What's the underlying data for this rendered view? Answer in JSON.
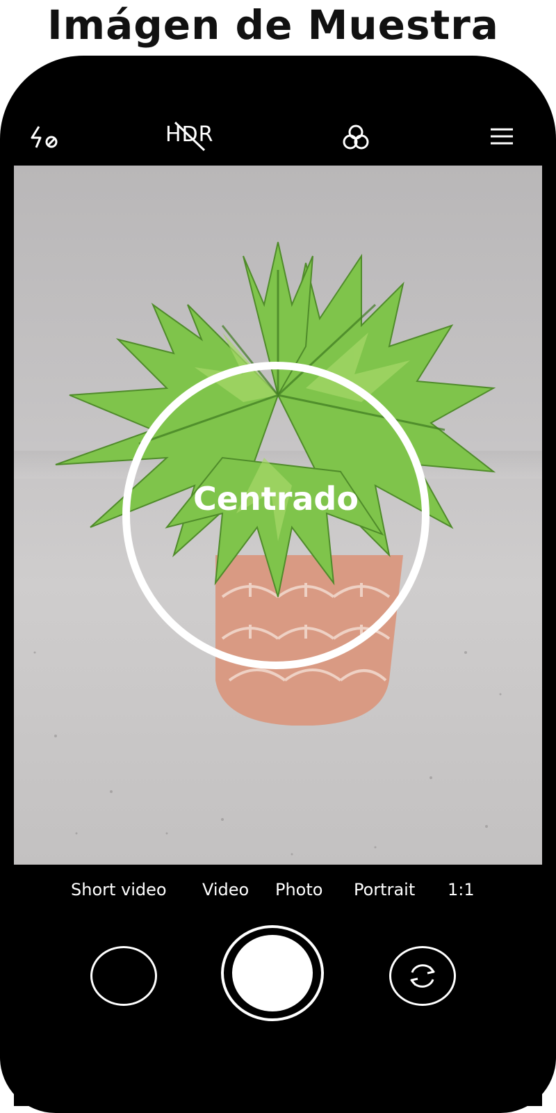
{
  "header": {
    "title": "Imágen de Muestra"
  },
  "camera": {
    "topbar": {
      "flash_icon": "flash-off-icon",
      "hdr_label": "HDR",
      "filters_icon": "filters-icon",
      "menu_icon": "menu-icon"
    },
    "viewfinder": {
      "focus_label": "Centrado"
    },
    "modes": [
      "Short video",
      "Video",
      "Photo",
      "Portrait",
      "1:1"
    ],
    "controls": {
      "gallery_icon": "gallery-thumbnail",
      "shutter_icon": "shutter-button",
      "switch_icon": "switch-camera-icon"
    }
  },
  "colors": {
    "background": "#ffffff",
    "phone_body": "#000000",
    "ui_foreground": "#ffffff",
    "leaf_green": "#7fc44b",
    "pot_terracotta": "#d99a83"
  }
}
